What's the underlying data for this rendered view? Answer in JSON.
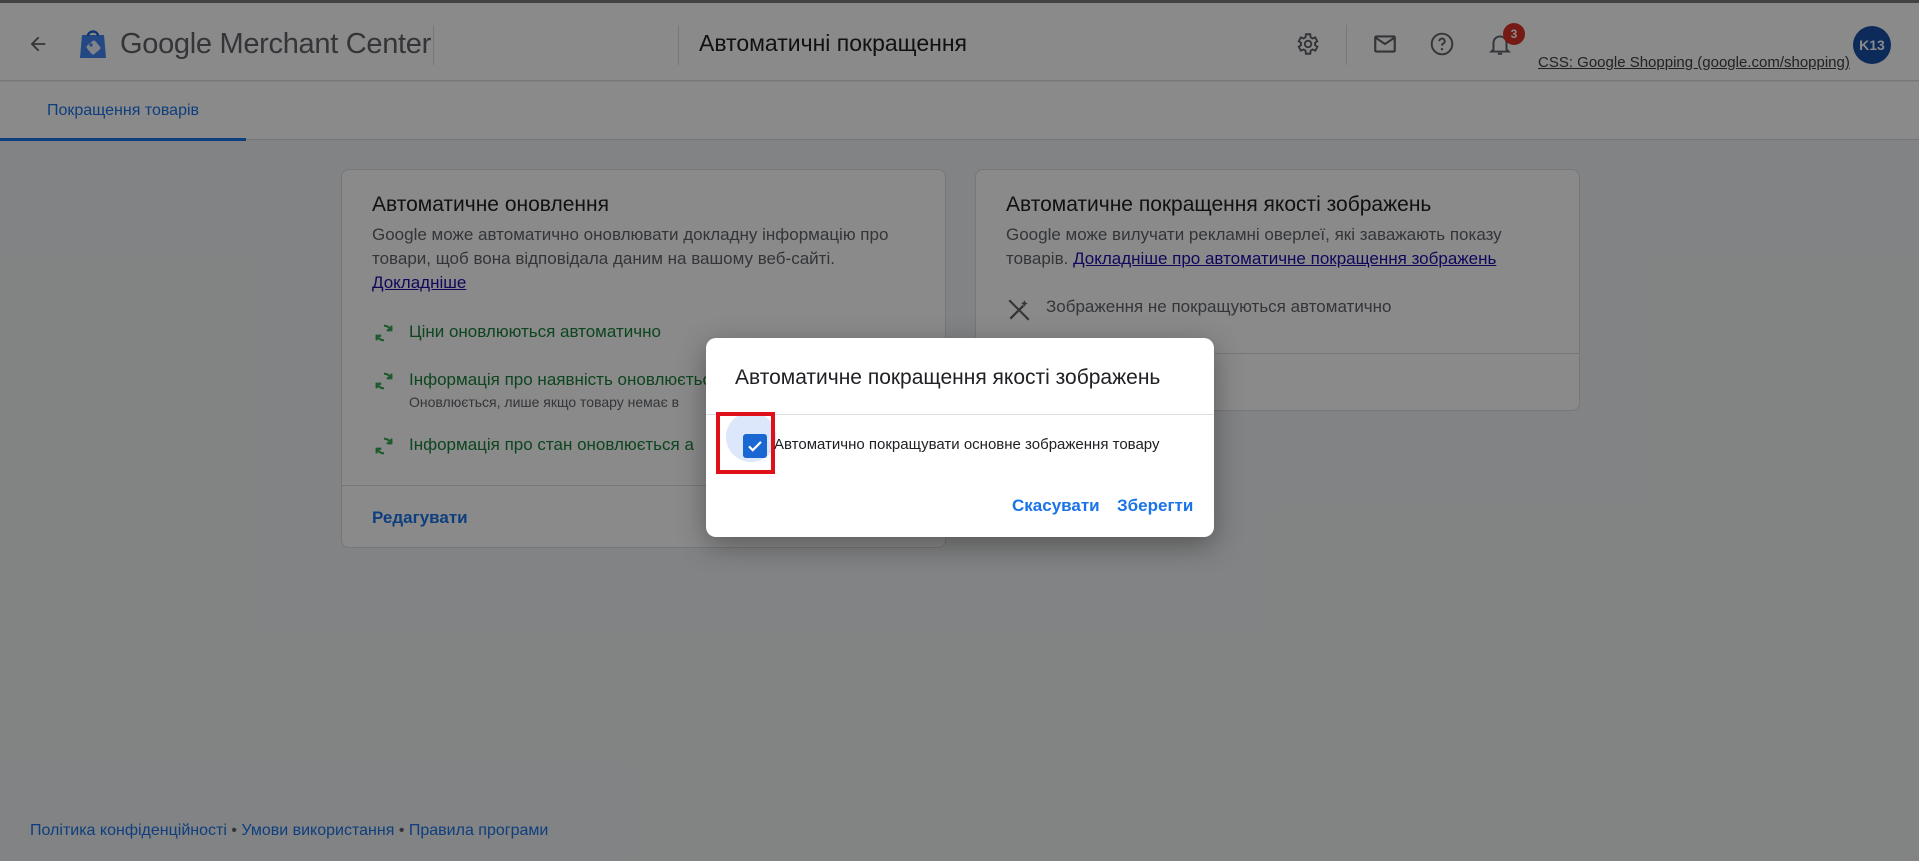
{
  "header": {
    "brand_google": "Google",
    "brand_product": "Merchant Center",
    "page_title": "Автоматичні покращення",
    "notification_count": "3",
    "account_name": "CSS: Google Shopping (google.com/shopping)",
    "avatar_initials": "K13"
  },
  "tabs": [
    {
      "label": "Покращення товарів",
      "active": true
    }
  ],
  "card_left": {
    "title": "Автоматичне оновлення",
    "description": "Google може автоматично оновлювати докладну інформацію про товари, щоб вона відповідала даним на вашому веб-сайті.",
    "link": "Докладніше",
    "statuses": [
      {
        "text": "Ціни оновлюються автоматично",
        "sub": ""
      },
      {
        "text": "Інформація про наявність оновлюється",
        "sub": "Оновлюється, лише якщо товару немає в"
      },
      {
        "text": "Інформація про стан оновлюється а",
        "sub": ""
      }
    ],
    "edit_label": "Редагувати"
  },
  "card_right": {
    "title": "Автоматичне покращення якості зображень",
    "description": "Google може вилучати рекламні оверлеї, які заважають показу товарів.",
    "link": "Докладніше про автоматичне покращення зображень",
    "status": "Зображення не покращуються автоматично"
  },
  "dialog": {
    "title": "Автоматичне покращення якості зображень",
    "checkbox_label": "Автоматично покращувати основне зображення товару",
    "checkbox_checked": true,
    "cancel_label": "Скасувати",
    "save_label": "Зберегти"
  },
  "footer": {
    "privacy": "Політика конфіденційності",
    "terms": "Умови використання",
    "rules": "Правила програми",
    "separator": "•"
  },
  "colors": {
    "accent": "#1a73e8",
    "status_green": "#188038",
    "badge_red": "#d93025",
    "avatar_blue": "#174ea6",
    "highlight_red": "#e0101a"
  }
}
